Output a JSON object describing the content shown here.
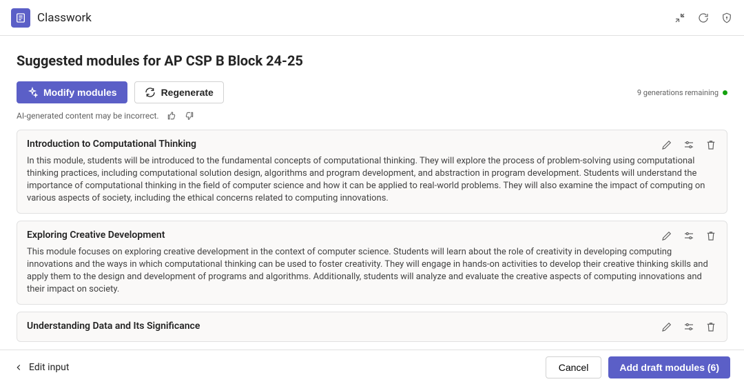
{
  "header": {
    "app_name": "Classwork"
  },
  "page": {
    "title": "Suggested modules for AP CSP B Block 24-25",
    "modify_label": "Modify modules",
    "regenerate_label": "Regenerate",
    "generations_remaining": "9 generations remaining",
    "ai_note": "AI-generated content may be incorrect."
  },
  "modules": [
    {
      "title": "Introduction to Computational Thinking",
      "description": "In this module, students will be introduced to the fundamental concepts of computational thinking. They will explore the process of problem-solving using computational thinking practices, including computational solution design, algorithms and program development, and abstraction in program development. Students will understand the importance of computational thinking in the field of computer science and how it can be applied to real-world problems. They will also examine the impact of computing on various aspects of society, including the ethical concerns related to computing innovations."
    },
    {
      "title": "Exploring Creative Development",
      "description": "This module focuses on exploring creative development in the context of computer science. Students will learn about the role of creativity in developing computing innovations and the ways in which computational thinking can be used to foster creativity. They will engage in hands-on activities to develop their creative thinking skills and apply them to the design and development of programs and algorithms. Additionally, students will analyze and evaluate the creative aspects of computing innovations and their impact on society."
    },
    {
      "title": "Understanding Data and Its Significance",
      "description": ""
    }
  ],
  "footer": {
    "edit_input": "Edit input",
    "cancel": "Cancel",
    "add_draft_modules": "Add draft modules (6)"
  }
}
